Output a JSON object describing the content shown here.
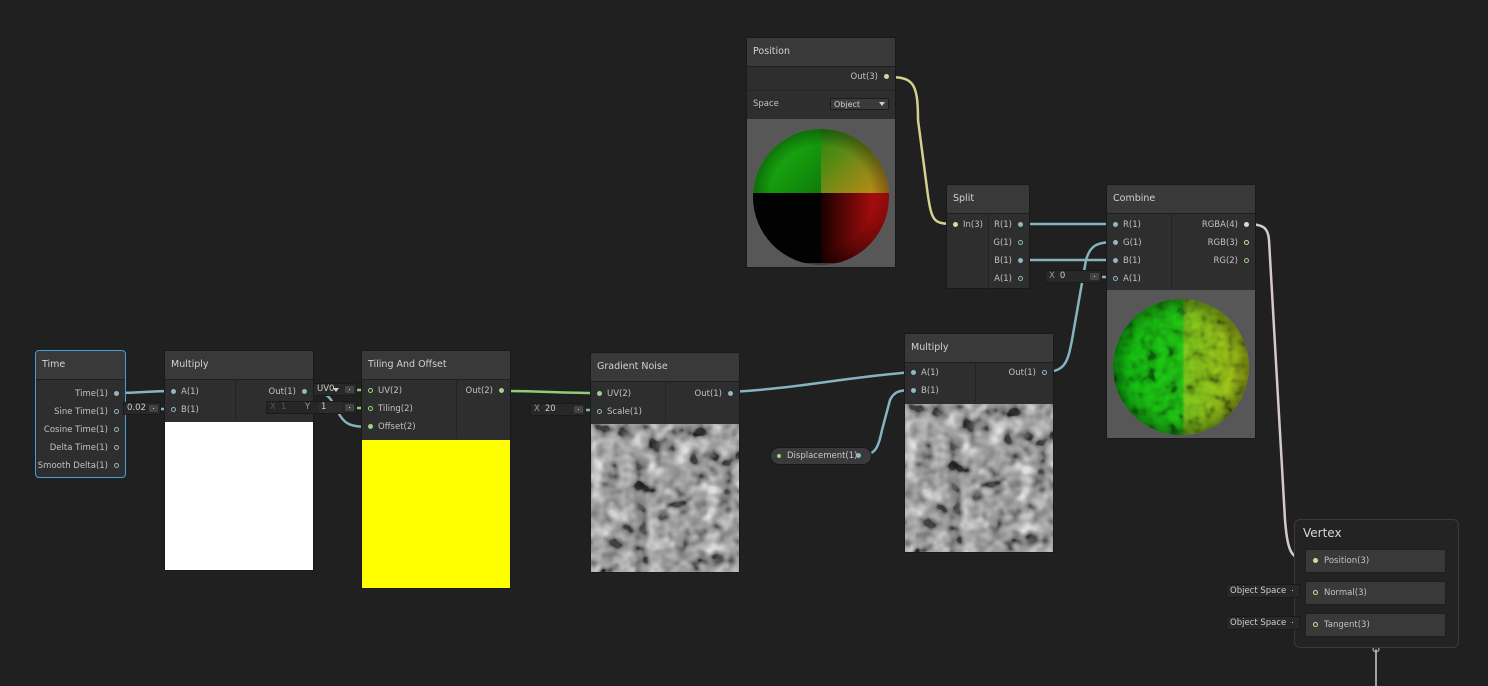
{
  "position_node": {
    "title": "Position",
    "out_label": "Out(3)",
    "space_label": "Space",
    "space_value": "Object"
  },
  "split_node": {
    "title": "Split",
    "in_label": "In(3)",
    "outputs": [
      "R(1)",
      "G(1)",
      "B(1)",
      "A(1)"
    ]
  },
  "combine_node": {
    "title": "Combine",
    "inputs": [
      "R(1)",
      "G(1)",
      "B(1)",
      "A(1)"
    ],
    "outputs": [
      "RGBA(4)",
      "RGB(3)",
      "RG(2)"
    ],
    "a_field": {
      "axis": "X",
      "value": "0"
    }
  },
  "time_node": {
    "title": "Time",
    "outputs": [
      "Time(1)",
      "Sine Time(1)",
      "Cosine Time(1)",
      "Delta Time(1)",
      "Smooth Delta(1)"
    ]
  },
  "multiply1_node": {
    "title": "Multiply",
    "inputs": [
      "A(1)",
      "B(1)"
    ],
    "out_label": "Out(1)",
    "b_field_value": "0.02"
  },
  "tiling_node": {
    "title": "Tiling And Offset",
    "inputs": [
      "UV(2)",
      "Tiling(2)",
      "Offset(2)"
    ],
    "out_label": "Out(2)",
    "uv_field_value": "UV0",
    "tiling_x_label": "X",
    "tiling_x_value": "1",
    "tiling_y_label": "Y",
    "tiling_y_value": "1",
    "preview_color": "#ffff00"
  },
  "noise_node": {
    "title": "Gradient Noise",
    "inputs": [
      "UV(2)",
      "Scale(1)"
    ],
    "out_label": "Out(1)",
    "scale_field": {
      "axis": "X",
      "value": "20"
    }
  },
  "multiply2_node": {
    "title": "Multiply",
    "inputs": [
      "A(1)",
      "B(1)"
    ],
    "out_label": "Out(1)"
  },
  "property_pill": {
    "label": "Displacement(1)"
  },
  "vertex_node": {
    "title": "Vertex",
    "ports": [
      "Position(3)",
      "Normal(3)",
      "Tangent(3)"
    ],
    "normal_space": "Object Space",
    "tangent_space": "Object Space"
  },
  "colors": {
    "background": "#202020",
    "node": "#2e2e2e",
    "node_header": "#393939",
    "selection": "#44a0d8",
    "wire_vector1": "#84b4c0",
    "wire_vector2": "#8ccf78",
    "wire_vector3": "#d2d28c",
    "wire_vector4": "#d6c9c9"
  }
}
